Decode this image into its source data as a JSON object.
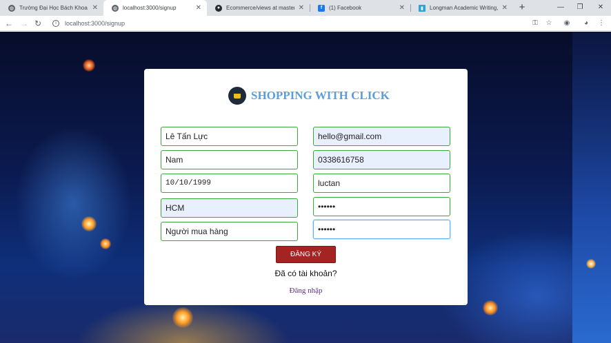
{
  "browser": {
    "tabs": [
      {
        "title": "Trường Đại Học Bách Khoa Tp.H",
        "favicon": "globe-icon",
        "active": false
      },
      {
        "title": "localhost:3000/signup",
        "favicon": "globe-icon",
        "active": true
      },
      {
        "title": "Ecommerce/views at master · n",
        "favicon": "github-icon",
        "active": false
      },
      {
        "title": "(1) Facebook",
        "favicon": "facebook-icon",
        "active": false
      },
      {
        "title": "Longman Academic Writing, Se",
        "favicon": "book-icon",
        "active": false
      }
    ],
    "url": "localhost:3000/signup",
    "colors": {
      "tabbar": "#dee1e6",
      "facebook": "#1877f2",
      "longman": "#2aa3d6"
    }
  },
  "page": {
    "brand_title": "SHOPPING WITH CLICK",
    "fields": {
      "full_name": "Lê Tấn Lực",
      "email": "hello@gmail.com",
      "gender": "Nam",
      "phone": "0338616758",
      "birthday": "10/10/1999",
      "username": "luctan",
      "city": "HCM",
      "password": "••••••",
      "role": "Người mua hàng",
      "confirm_password": "••••••"
    },
    "submit_label": "ĐĂNG KÝ",
    "have_account_text": "Đã có tài khoản?",
    "login_link": "Đăng nhập",
    "colors": {
      "brand": "#5b9ddb",
      "field_border": "#38a838",
      "submit": "#a42424",
      "link": "#5b2a7a"
    }
  }
}
